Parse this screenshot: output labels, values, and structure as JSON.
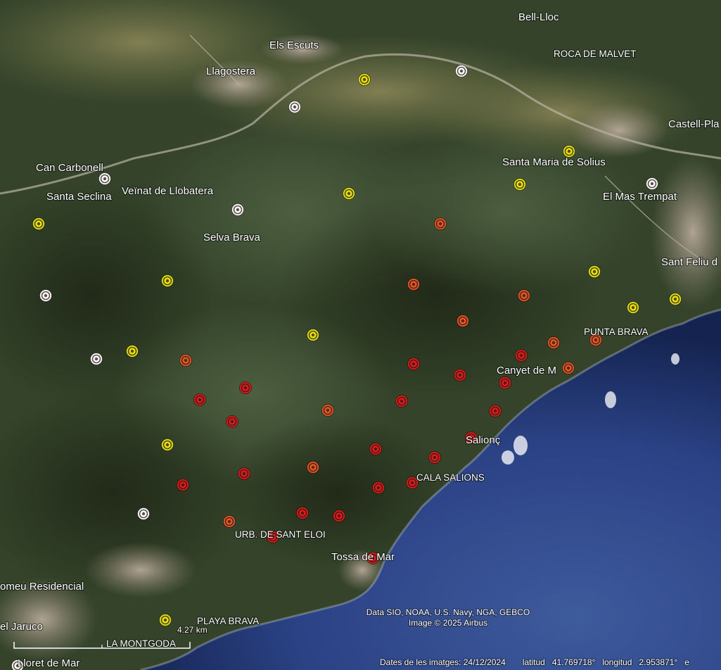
{
  "map": {
    "colors": {
      "land": "#3a4a2c",
      "sea_deep": "#1f2f6e",
      "sea_shallow": "#35508f",
      "urban": "#a59b8f",
      "marker_red": "#d81f1f",
      "marker_orange": "#e2592b",
      "marker_yellow": "#e3e31a",
      "marker_white": "#ffffff"
    },
    "place_labels": [
      {
        "id": "bell-lloc",
        "text": "Bell-Lloc"
      },
      {
        "id": "els-escuts",
        "text": "Els Escuts"
      },
      {
        "id": "roca-de-malvet",
        "text": "ROCA DE MALVET"
      },
      {
        "id": "llagostera",
        "text": "Llagostera"
      },
      {
        "id": "castell-platja",
        "text": "Castell-Pla"
      },
      {
        "id": "can-carbonell",
        "text": "Can Carbonell"
      },
      {
        "id": "santa-maria-de-solius",
        "text": "Santa Maria de Solius"
      },
      {
        "id": "santa-seclina",
        "text": "Santa Seclina"
      },
      {
        "id": "veinat-de-llobatera",
        "text": "Veïnat de Llobatera"
      },
      {
        "id": "el-mas-trempat",
        "text": "El Mas Trempat"
      },
      {
        "id": "selva-brava",
        "text": "Selva Brava"
      },
      {
        "id": "sant-feliu",
        "text": "Sant Feliu d"
      },
      {
        "id": "punta-brava",
        "text": "PUNTA BRAVA"
      },
      {
        "id": "canyet-de-mar",
        "text": "Canyet de M"
      },
      {
        "id": "salionc",
        "text": "Salionç"
      },
      {
        "id": "cala-salions",
        "text": "CALA SALIONS"
      },
      {
        "id": "urb-sant-eloi",
        "text": "URB. DE SANT ELOI"
      },
      {
        "id": "tossa-de-mar",
        "text": "Tossa de Mar"
      },
      {
        "id": "residencial",
        "text": "omeu Residencial"
      },
      {
        "id": "el-jaruco",
        "text": "el Jaruco"
      },
      {
        "id": "playa-brava",
        "text": "PLAYA BRAVA"
      },
      {
        "id": "la-montgoda",
        "text": "LA MONTGODA"
      },
      {
        "id": "lloret-de-mar",
        "text": "Lloret de Mar"
      }
    ],
    "markers": [
      {
        "level": "white"
      },
      {
        "level": "white"
      },
      {
        "level": "white"
      },
      {
        "level": "white"
      },
      {
        "level": "white"
      },
      {
        "level": "white"
      },
      {
        "level": "white"
      },
      {
        "level": "white"
      },
      {
        "level": "white"
      },
      {
        "level": "yellow"
      },
      {
        "level": "yellow"
      },
      {
        "level": "yellow"
      },
      {
        "level": "yellow"
      },
      {
        "level": "yellow"
      },
      {
        "level": "yellow"
      },
      {
        "level": "yellow"
      },
      {
        "level": "yellow"
      },
      {
        "level": "yellow"
      },
      {
        "level": "yellow"
      },
      {
        "level": "yellow"
      },
      {
        "level": "yellow"
      },
      {
        "level": "yellow"
      },
      {
        "level": "orange"
      },
      {
        "level": "orange"
      },
      {
        "level": "orange"
      },
      {
        "level": "orange"
      },
      {
        "level": "orange"
      },
      {
        "level": "orange"
      },
      {
        "level": "orange"
      },
      {
        "level": "orange"
      },
      {
        "level": "orange"
      },
      {
        "level": "orange"
      },
      {
        "level": "orange"
      },
      {
        "level": "red"
      },
      {
        "level": "red"
      },
      {
        "level": "red"
      },
      {
        "level": "red"
      },
      {
        "level": "red"
      },
      {
        "level": "red"
      },
      {
        "level": "red"
      },
      {
        "level": "red"
      },
      {
        "level": "red"
      },
      {
        "level": "red"
      },
      {
        "level": "red"
      },
      {
        "level": "red"
      },
      {
        "level": "red"
      },
      {
        "level": "red"
      },
      {
        "level": "red"
      },
      {
        "level": "red"
      },
      {
        "level": "red"
      },
      {
        "level": "red"
      },
      {
        "level": "red"
      },
      {
        "level": "red"
      }
    ],
    "scale_label": "4.27 km",
    "attribution_line1": "Data SIO, NOAA, U.S. Navy, NGA, GEBCO",
    "attribution_line2": "Image © 2025 Airbus"
  },
  "status_bar": {
    "imagery_date": "Dates de les imatges: 24/12/2024",
    "latitude_label": "latitud",
    "latitude_value": "41.769718°",
    "longitude_label": "longitud",
    "longitude_value": "2.953871°",
    "elevation_label": "e"
  }
}
